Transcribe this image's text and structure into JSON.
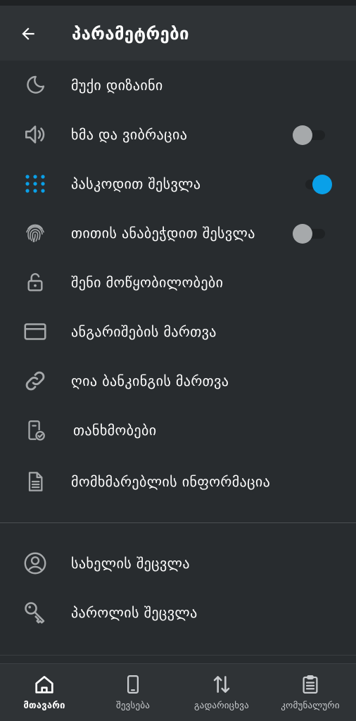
{
  "header": {
    "title": "პარამეტრები"
  },
  "menu": {
    "dark_mode": "მუქი დიზაინი",
    "sound_vibration": "ხმა და ვიბრაცია",
    "passcode_login": "პასკოდით შესვლა",
    "fingerprint_login": "თითის ანაბეჭდით შესვლა",
    "your_devices": "შენი მოწყობილობები",
    "accounts_management": "ანგარიშების მართვა",
    "open_banking": "ღია ბანკინგის მართვა",
    "consents": "თანხმობები",
    "user_info": "მომხმარებლის ინფორმაცია",
    "change_name": "სახელის შეცვლა",
    "change_password": "პაროლის შეცვლა"
  },
  "toggles": {
    "sound_vibration": false,
    "passcode_login": true,
    "fingerprint_login": false
  },
  "bottom_nav": {
    "home": "მთავარი",
    "purchases": "შევსება",
    "transfers": "გადარიცხვა",
    "utilities": "კომუნალური"
  },
  "colors": {
    "background": "#282c2f",
    "accent": "#0aa0e8",
    "icon": "#a6a9ab"
  }
}
